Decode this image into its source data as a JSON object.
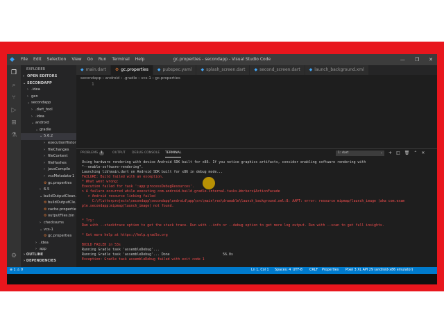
{
  "titlebar": {
    "menu": [
      "File",
      "Edit",
      "Selection",
      "View",
      "Go",
      "Run",
      "Terminal",
      "Help"
    ],
    "window_title": "gc.properties - secondapp - Visual Studio Code",
    "controls": [
      "—",
      "❐",
      "✕"
    ]
  },
  "sidebar": {
    "title": "EXPLORER",
    "open_editors": "OPEN EDITORS",
    "root": "SECONDAPP",
    "items": [
      {
        "label": ".idea",
        "indent": 1,
        "type": "dir",
        "open": false
      },
      {
        "label": "gen",
        "indent": 1,
        "type": "dir",
        "open": false
      },
      {
        "label": "secondapp",
        "indent": 1,
        "type": "dir",
        "open": true
      },
      {
        "label": ".dart_tool",
        "indent": 2,
        "type": "dir",
        "open": false
      },
      {
        "label": ".idea",
        "indent": 2,
        "type": "dir",
        "open": false
      },
      {
        "label": "android",
        "indent": 2,
        "type": "dir",
        "open": true
      },
      {
        "label": "gradle",
        "indent": 3,
        "type": "dir",
        "open": true
      },
      {
        "label": "5.6.2",
        "indent": 4,
        "type": "dir",
        "open": true,
        "selected": true
      },
      {
        "label": "executionHistory",
        "indent": 5,
        "type": "dir",
        "open": false
      },
      {
        "label": "fileChanges",
        "indent": 5,
        "type": "dir",
        "open": false
      },
      {
        "label": "fileContent",
        "indent": 5,
        "type": "dir",
        "open": false
      },
      {
        "label": "fileHashes",
        "indent": 5,
        "type": "dir",
        "open": false
      },
      {
        "label": "javaCompile",
        "indent": 5,
        "type": "dir",
        "open": false
      },
      {
        "label": "vcsMetadata-1",
        "indent": 5,
        "type": "dir",
        "open": false
      },
      {
        "label": "gc.properties",
        "indent": 5,
        "type": "file"
      },
      {
        "label": "6.5",
        "indent": 4,
        "type": "dir",
        "open": false
      },
      {
        "label": "buildOutputClean...",
        "indent": 4,
        "type": "dir",
        "open": true
      },
      {
        "label": "buildOutputCle...",
        "indent": 5,
        "type": "file"
      },
      {
        "label": "cache.properties",
        "indent": 5,
        "type": "file"
      },
      {
        "label": "outputFiles.bin",
        "indent": 5,
        "type": "file"
      },
      {
        "label": "checksums",
        "indent": 4,
        "type": "dir",
        "open": false
      },
      {
        "label": "vcs-1",
        "indent": 4,
        "type": "dir",
        "open": true
      },
      {
        "label": "gc.properties",
        "indent": 5,
        "type": "file"
      },
      {
        "label": ".idea",
        "indent": 3,
        "type": "dir",
        "open": false
      },
      {
        "label": "app",
        "indent": 3,
        "type": "dir",
        "open": false
      }
    ],
    "outline": "OUTLINE",
    "dependencies": "DEPENDENCIES"
  },
  "tabs": [
    {
      "label": "main.dart",
      "active": false
    },
    {
      "label": "gc.properties",
      "active": true
    },
    {
      "label": "pubspec.yaml",
      "active": false
    },
    {
      "label": "splash_screen.dart",
      "active": false
    },
    {
      "label": "second_screen.dart",
      "active": false
    },
    {
      "label": "launch_background.xml",
      "active": false
    }
  ],
  "breadcrumb": "secondapp › android › .gradle › vcs-1 › gc.properties",
  "editor": {
    "line_number": "1"
  },
  "panel": {
    "tabs": {
      "problems": "PROBLEMS",
      "problems_count": "1",
      "output": "OUTPUT",
      "debug_console": "DEBUG CONSOLE",
      "terminal": "TERMINAL"
    },
    "terminal_select": "1: dart",
    "lines": [
      {
        "text": "Using hardware rendering with device Android SDK built for x86. If you notice graphics artifacts, consider enabling software rendering with",
        "kind": "dim"
      },
      {
        "text": "\"--enable-software-rendering\".",
        "kind": "dim"
      },
      {
        "text": "Launching lib\\main.dart on Android SDK built for x86 in debug mode...",
        "kind": "dim"
      },
      {
        "text": "FAILURE: Build failed with an exception.",
        "kind": "err"
      },
      {
        "text": "* What went wrong:",
        "kind": "err"
      },
      {
        "text": "Execution failed for task ':app:processDebugResources'.",
        "kind": "err"
      },
      {
        "text": "> A failure occurred while executing com.android.build.gradle.internal.tasks.Workers$ActionFacade",
        "kind": "err"
      },
      {
        "text": "   > Android resource linking failed",
        "kind": "err"
      },
      {
        "text": "     C:\\flutterprojects\\secondapp\\secondapp\\android\\app\\src\\main\\res\\drawable\\launch_background.xml:8: AAPT: error: resource mipmap/launch_image (aka com.exam",
        "kind": "err"
      },
      {
        "text": "ple.secondapp:mipmap/launch_image) not found.",
        "kind": "err"
      },
      {
        "text": "",
        "kind": "dim"
      },
      {
        "text": "",
        "kind": "dim"
      },
      {
        "text": "* Try:",
        "kind": "err"
      },
      {
        "text": "Run with --stacktrace option to get the stack trace. Run with --info or --debug option to get more log output. Run with --scan to get full insights.",
        "kind": "err"
      },
      {
        "text": "",
        "kind": "dim"
      },
      {
        "text": "* Get more help at https://help.gradle.org",
        "kind": "err"
      },
      {
        "text": "",
        "kind": "dim"
      },
      {
        "text": "BUILD FAILED in 53s",
        "kind": "err"
      },
      {
        "text": "Running Gradle task 'assembleDebug'...",
        "kind": "dim"
      },
      {
        "text": "Running Gradle task 'assembleDebug'... Done                          56.0s",
        "kind": "dim"
      },
      {
        "text": "Exception: Gradle task assembleDebug failed with exit code 1",
        "kind": "err"
      }
    ]
  },
  "statusbar": {
    "position": "Ln 1, Col 1",
    "spaces": "Spaces: 4",
    "encoding": "UTF-8",
    "eol": "CRLF",
    "language": "Properties",
    "device": "Pixel 3 XL API 29 (android-x86 emulator)"
  },
  "colors": {
    "accent": "#007acc",
    "frame": "#e8161d",
    "error": "#f14c4c"
  }
}
